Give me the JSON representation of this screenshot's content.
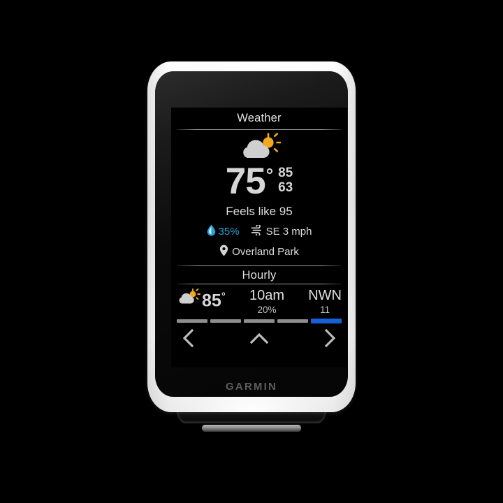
{
  "device": {
    "brand": "GARMIN",
    "brand_icon": "garmin-wordmark"
  },
  "screen": {
    "weather": {
      "title": "Weather",
      "condition_icon": "partly-cloudy-icon",
      "temperature": "75",
      "degree_symbol": "°",
      "high": "85",
      "low": "63",
      "feels_like": "Feels like 95",
      "humidity_icon": "water-drop-icon",
      "humidity": "35%",
      "humidity_color": "#2a9fd8",
      "wind_icon": "wind-icon",
      "wind": "SE 3 mph",
      "location_icon": "map-pin-icon",
      "location": "Overland Park"
    },
    "hourly": {
      "title": "Hourly",
      "condition_icon": "partly-cloudy-small-icon",
      "temperature": "85",
      "degree_symbol": "°",
      "time": "10am",
      "precip_chance": "20%",
      "wind_direction": "NWN",
      "wind_speed": "11"
    },
    "pager": {
      "total": 5,
      "active_index": 5,
      "active_color": "#1761d8",
      "inactive_color": "#8e8e8e"
    },
    "nav": {
      "back_icon": "chevron-left-icon",
      "up_icon": "chevron-up-icon",
      "forward_icon": "chevron-right-icon"
    }
  }
}
